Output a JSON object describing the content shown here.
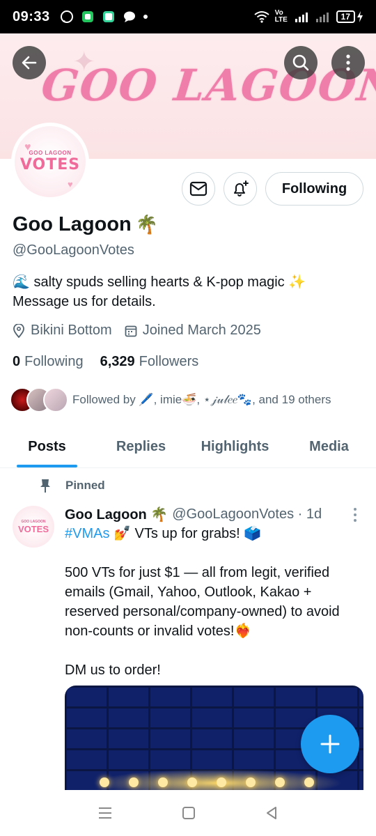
{
  "status_bar": {
    "time": "09:33",
    "network_label": "Vo LTE",
    "battery": "17"
  },
  "banner": {
    "title": "GOO LAGOON"
  },
  "avatar": {
    "small_text": "GOO LAGOON",
    "big_text": "VOTES"
  },
  "profile": {
    "following_button": "Following",
    "name": "Goo Lagoon",
    "name_emoji": "🌴",
    "handle": "@GooLagoonVotes",
    "bio_line1": "🌊 salty spuds selling hearts & K-pop magic ✨",
    "bio_line2": "Message us for details.",
    "location": "Bikini Bottom",
    "joined": "Joined March 2025",
    "following_count": "0",
    "following_label": "Following",
    "followers_count": "6,329",
    "followers_label": "Followers",
    "followed_by": "Followed by 🖊️, imie🍜, ⋆𝒿𝓊𝓁𝑒𝑒🐾, and 19 others"
  },
  "tabs": [
    "Posts",
    "Replies",
    "Highlights",
    "Media"
  ],
  "tweet": {
    "pinned_label": "Pinned",
    "name": "Goo Lagoon 🌴",
    "handle_time": "@GooLagoonVotes · 1d",
    "hashtag": "#VMAs",
    "line1_rest": " 💅  VTs up for grabs! 🗳️",
    "paragraph2": "500 VTs for just $1 — all from legit, verified emails (Gmail, Yahoo, Outlook, Kakao + reserved personal/company-owned) to avoid non-counts or invalid votes!❤️‍🔥",
    "paragraph3": "DM us to order!"
  },
  "colors": {
    "accent": "#1d9bf0",
    "banner_text": "#f07eaa",
    "secondary_text": "#536471"
  }
}
